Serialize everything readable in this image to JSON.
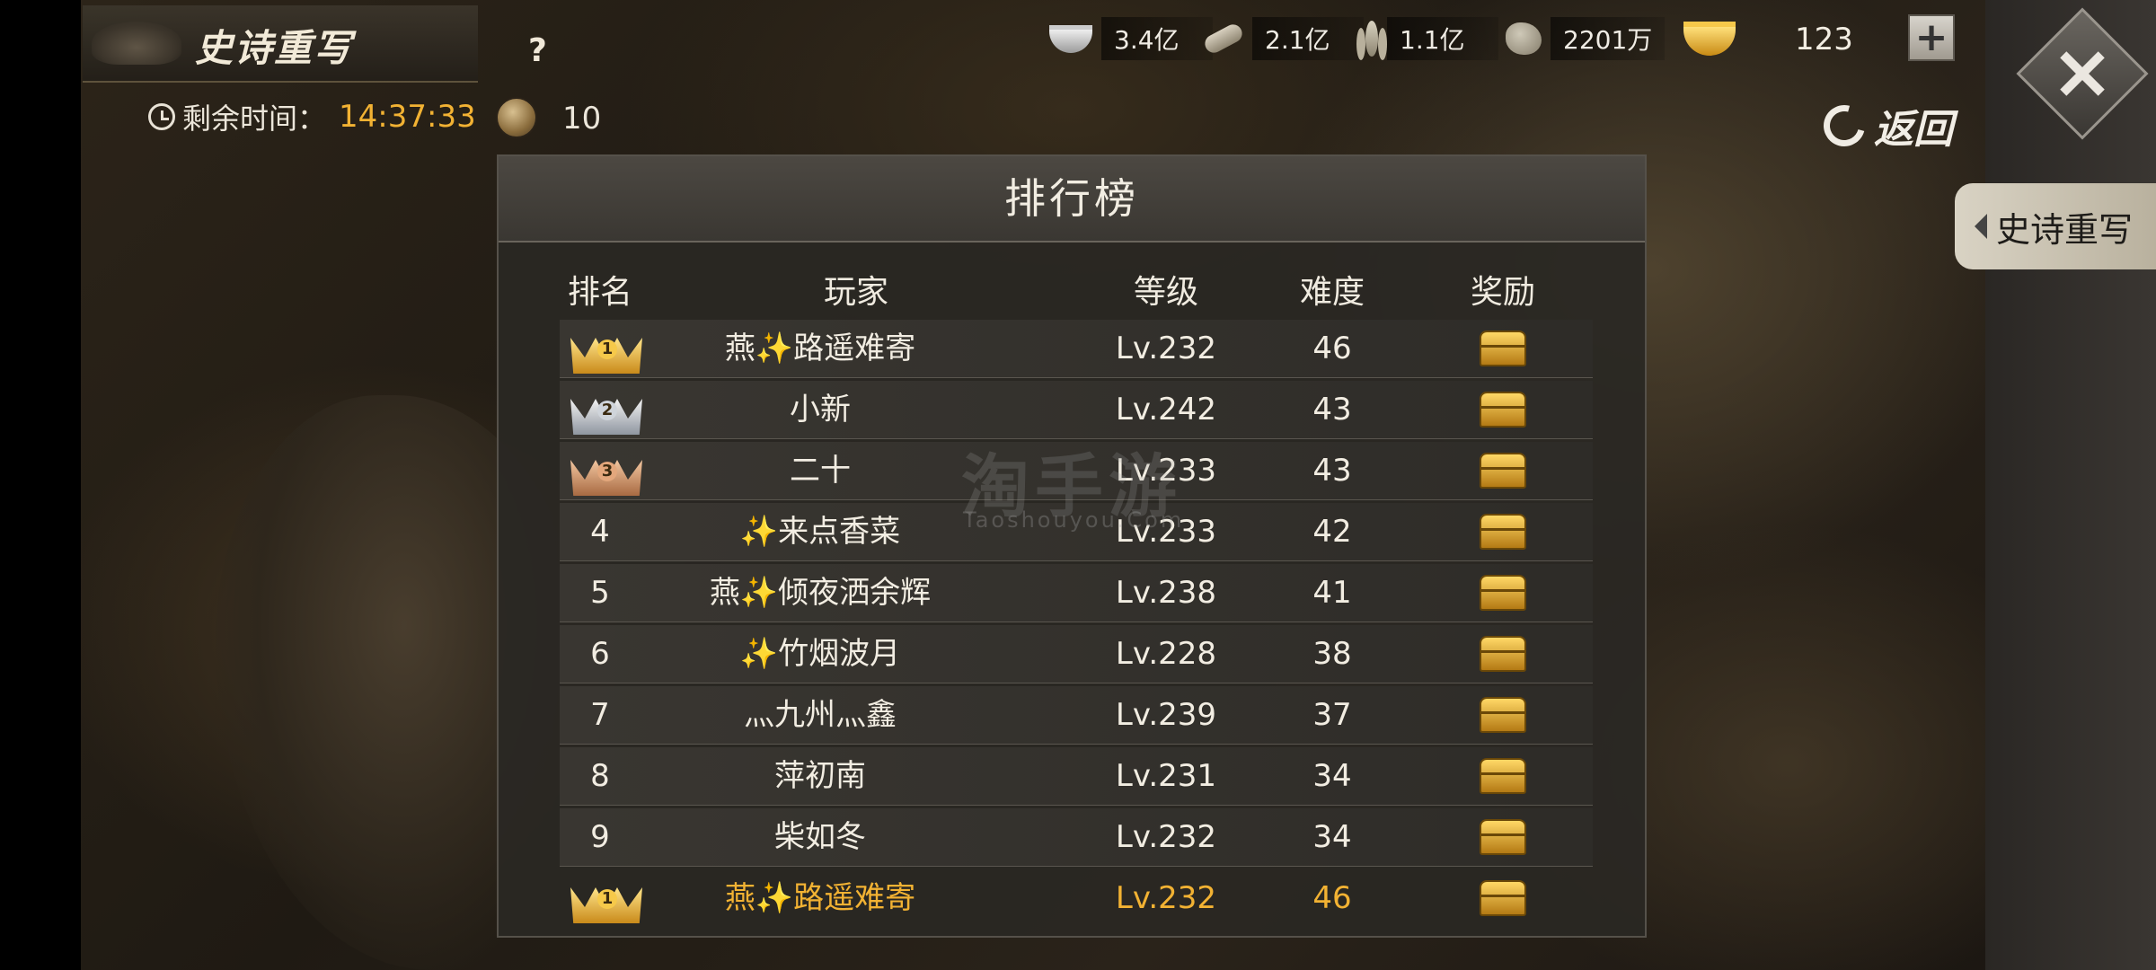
{
  "header": {
    "title": "史诗重写",
    "help": "?",
    "timer_label": "剩余时间：",
    "timer_value": "14:37:33",
    "token_count": "10"
  },
  "resources": {
    "silver": "3.4亿",
    "wood": "2.1亿",
    "grain": "1.1亿",
    "stone": "2201万",
    "gold": "123",
    "plus": "+"
  },
  "nav": {
    "back_label": "返回",
    "side_tab_label": "史诗重写"
  },
  "leaderboard": {
    "title": "排行榜",
    "columns": {
      "rank": "排名",
      "player": "玩家",
      "level": "等级",
      "difficulty": "难度",
      "reward": "奖励"
    },
    "rows": [
      {
        "rank": "1",
        "medal": "gold",
        "name": "燕✨路遥难寄",
        "level": "Lv.232",
        "difficulty": "46"
      },
      {
        "rank": "2",
        "medal": "silver",
        "name": "小新",
        "level": "Lv.242",
        "difficulty": "43"
      },
      {
        "rank": "3",
        "medal": "bronze",
        "name": "二十",
        "level": "Lv.233",
        "difficulty": "43"
      },
      {
        "rank": "4",
        "medal": "",
        "name": "✨来点香菜",
        "level": "Lv.233",
        "difficulty": "42"
      },
      {
        "rank": "5",
        "medal": "",
        "name": "燕✨倾夜洒余辉",
        "level": "Lv.238",
        "difficulty": "41"
      },
      {
        "rank": "6",
        "medal": "",
        "name": "✨竹烟波月",
        "level": "Lv.228",
        "difficulty": "38"
      },
      {
        "rank": "7",
        "medal": "",
        "name": "灬九州灬鑫",
        "level": "Lv.239",
        "difficulty": "37"
      },
      {
        "rank": "8",
        "medal": "",
        "name": "萍初南",
        "level": "Lv.231",
        "difficulty": "34"
      },
      {
        "rank": "9",
        "medal": "",
        "name": "柴如冬",
        "level": "Lv.232",
        "difficulty": "34"
      }
    ],
    "self_row": {
      "rank": "1",
      "medal": "gold",
      "name": "燕✨路遥难寄",
      "level": "Lv.232",
      "difficulty": "46"
    }
  },
  "watermark": {
    "main": "淘手游",
    "sub": "Taoshouyou.Com"
  },
  "colors": {
    "highlight": "#f2b233",
    "text": "#f2ede2"
  }
}
